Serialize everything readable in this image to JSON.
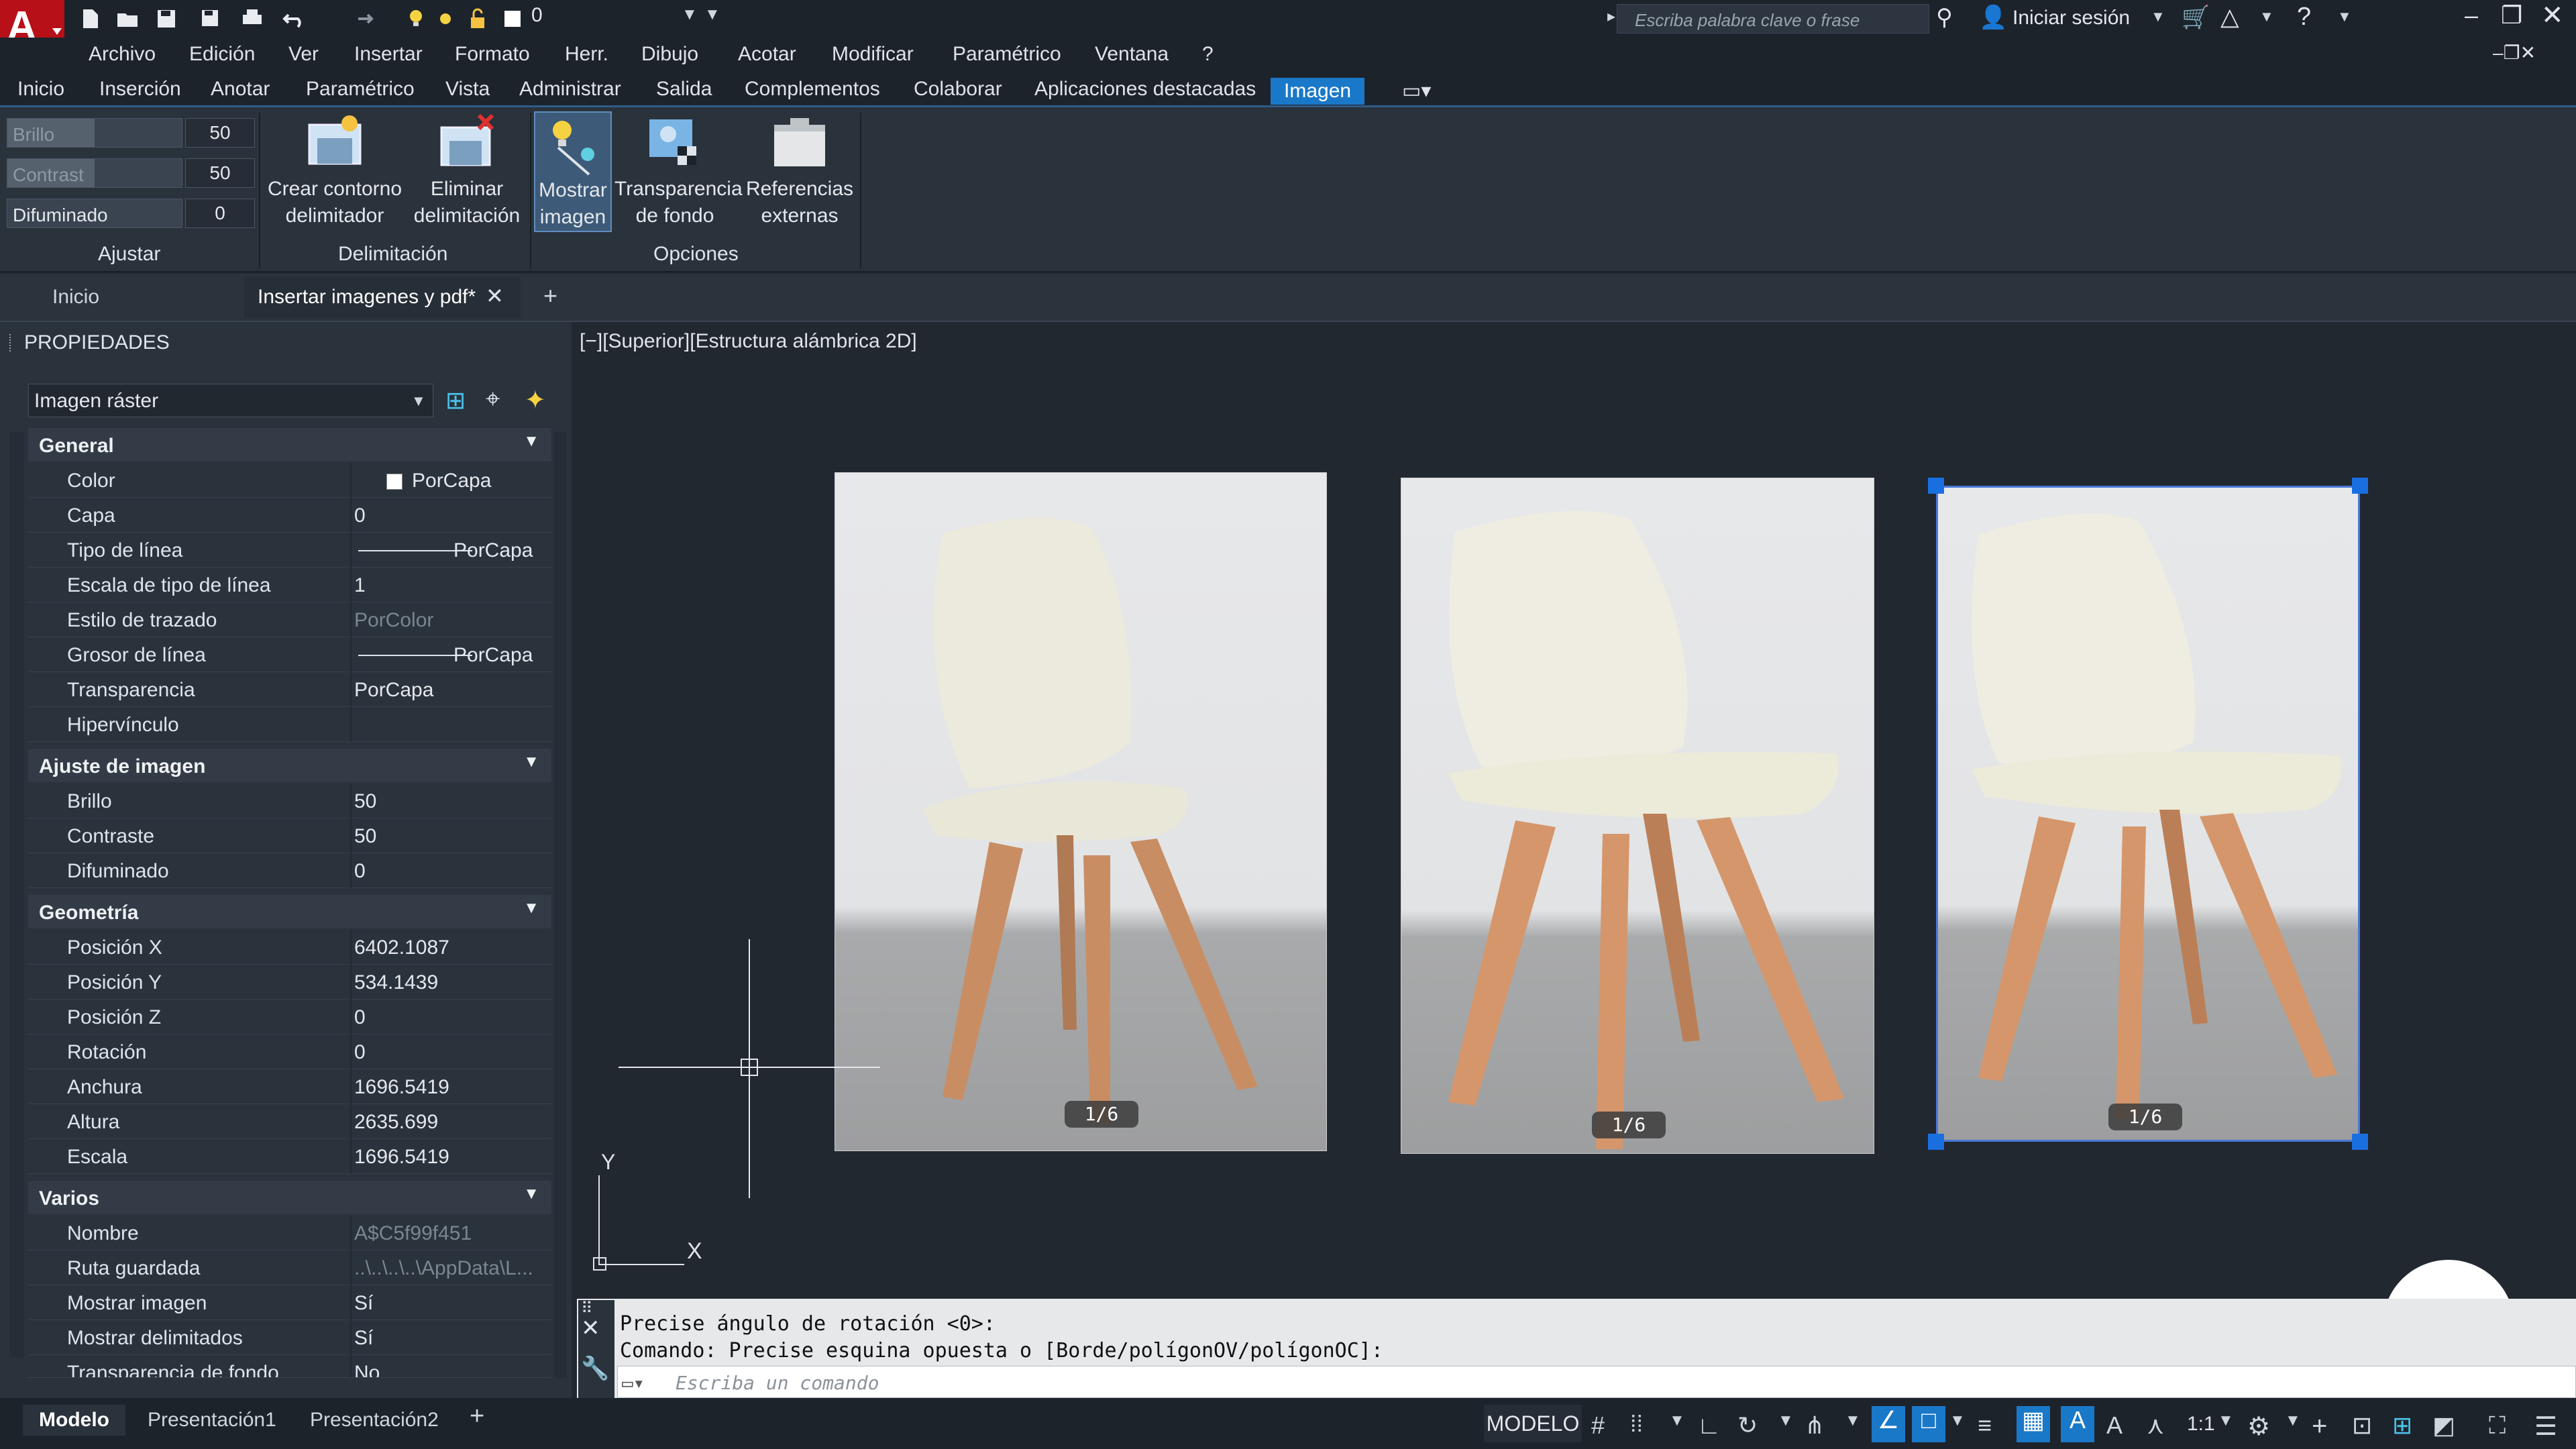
{
  "app": {
    "logo_letter": "A",
    "layer_value": "0",
    "search_placeholder": "Escriba palabra clave o frase",
    "signin_label": "Iniciar sesión"
  },
  "menu": [
    "Archivo",
    "Edición",
    "Ver",
    "Insertar",
    "Formato",
    "Herr.",
    "Dibujo",
    "Acotar",
    "Modificar",
    "Paramétrico",
    "Ventana",
    "?"
  ],
  "ribbon_tabs": [
    "Inicio",
    "Inserción",
    "Anotar",
    "Paramétrico",
    "Vista",
    "Administrar",
    "Salida",
    "Complementos",
    "Colaborar",
    "Aplicaciones destacadas",
    "Imagen"
  ],
  "ribbon": {
    "adjust": {
      "brightness_label": "Brillo",
      "brightness_value": "50",
      "brightness_fraction": 0.5,
      "contrast_label": "Contrast",
      "contrast_value": "50",
      "contrast_fraction": 0.5,
      "fade_label": "Difuminado",
      "fade_value": "0",
      "fade_fraction": 0.0,
      "panel": "Ajustar"
    },
    "clip": {
      "create_l1": "Crear contorno",
      "create_l2": "delimitador",
      "delete_l1": "Eliminar",
      "delete_l2": "delimitación",
      "panel": "Delimitación"
    },
    "options": {
      "show_l1": "Mostrar",
      "show_l2": "imagen",
      "transp_l1": "Transparencia",
      "transp_l2": "de fondo",
      "xref_l1": "Referencias",
      "xref_l2": "externas",
      "panel": "Opciones"
    }
  },
  "doc_tabs": {
    "home": "Inicio",
    "current": "Insertar imagenes y pdf*"
  },
  "properties": {
    "title": "PROPIEDADES",
    "object_type": "Imagen ráster",
    "general": {
      "header": "General",
      "rows": [
        {
          "k": "Color",
          "v": "PorCapa"
        },
        {
          "k": "Capa",
          "v": "0"
        },
        {
          "k": "Tipo de línea",
          "v": "PorCapa"
        },
        {
          "k": "Escala de tipo de línea",
          "v": "1"
        },
        {
          "k": "Estilo de trazado",
          "v": "PorColor"
        },
        {
          "k": "Grosor de línea",
          "v": "PorCapa"
        },
        {
          "k": "Transparencia",
          "v": "PorCapa"
        },
        {
          "k": "Hipervínculo",
          "v": ""
        }
      ]
    },
    "image_adjust": {
      "header": "Ajuste de imagen",
      "rows": [
        {
          "k": "Brillo",
          "v": "50"
        },
        {
          "k": "Contraste",
          "v": "50"
        },
        {
          "k": "Difuminado",
          "v": "0"
        }
      ]
    },
    "geometry": {
      "header": "Geometría",
      "rows": [
        {
          "k": "Posición X",
          "v": "6402.1087"
        },
        {
          "k": "Posición Y",
          "v": "534.1439"
        },
        {
          "k": "Posición Z",
          "v": "0"
        },
        {
          "k": "Rotación",
          "v": "0"
        },
        {
          "k": "Anchura",
          "v": "1696.5419"
        },
        {
          "k": "Altura",
          "v": "2635.699"
        },
        {
          "k": "Escala",
          "v": "1696.5419"
        }
      ]
    },
    "misc": {
      "header": "Varios",
      "rows": [
        {
          "k": "Nombre",
          "v": "A$C5f99f451"
        },
        {
          "k": "Ruta guardada",
          "v": "..\\..\\..\\..\\AppData\\L..."
        },
        {
          "k": "Mostrar imagen",
          "v": "Sí"
        },
        {
          "k": "Mostrar delimitados",
          "v": "Sí"
        },
        {
          "k": "Transparencia de fondo",
          "v": "No"
        }
      ]
    }
  },
  "viewport": {
    "label": "[−][Superior][Estructura alámbrica 2D]"
  },
  "images": [
    {
      "badge": "1/6"
    },
    {
      "badge": "1/6"
    },
    {
      "badge": "1/6"
    }
  ],
  "ucs": {
    "x": "X",
    "y": "Y"
  },
  "command": {
    "line1": "Precise ángulo de rotación <0>:",
    "line2": "Comando: Precise esquina opuesta o [Borde/polígonOV/polígonOC]:",
    "placeholder": "Escriba un comando"
  },
  "layouts": [
    "Modelo",
    "Presentación1",
    "Presentación2"
  ],
  "status": {
    "model": "MODELO",
    "scale": "1:1"
  },
  "colors": {
    "accent": "#1a78c8",
    "grip": "#1a6fe0",
    "brand_red": "#d0121b"
  }
}
